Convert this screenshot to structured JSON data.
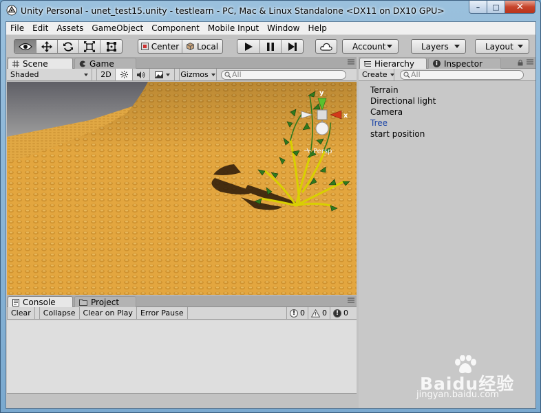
{
  "window": {
    "title": "Unity Personal - unet_test15.unity - testlearn - PC, Mac & Linux Standalone <DX11 on DX10 GPU>",
    "controls": {
      "minimize": "–",
      "maximize": "□",
      "close": "✕"
    }
  },
  "menu": {
    "items": [
      "File",
      "Edit",
      "Assets",
      "GameObject",
      "Component",
      "Mobile Input",
      "Window",
      "Help"
    ]
  },
  "toolbar": {
    "tools": [
      "view-tool",
      "move-tool",
      "rotate-tool",
      "scale-tool",
      "rect-tool"
    ],
    "pivot": {
      "center_label": "Center",
      "local_label": "Local"
    },
    "play_controls": [
      "play",
      "pause",
      "step"
    ],
    "account_label": "Account",
    "layers_label": "Layers",
    "layout_label": "Layout"
  },
  "scene": {
    "tabs": {
      "scene": "Scene",
      "game": "Game"
    },
    "shading": "Shaded",
    "mode_2d": "2D",
    "gizmos": "Gizmos",
    "search_placeholder": "All",
    "gizmo": {
      "y": "y",
      "x": "x",
      "persp": "Persp"
    }
  },
  "console": {
    "tabs": {
      "console": "Console",
      "project": "Project"
    },
    "buttons": [
      "Clear",
      "Collapse",
      "Clear on Play",
      "Error Pause"
    ],
    "counts": {
      "info": "0",
      "warning": "0",
      "error": "0"
    }
  },
  "hierarchy": {
    "tabs": {
      "hierarchy": "Hierarchy",
      "inspector": "Inspector"
    },
    "create_label": "Create",
    "search_placeholder": "All",
    "items": [
      {
        "label": "Terrain",
        "selected": false
      },
      {
        "label": "Directional light",
        "selected": false
      },
      {
        "label": "Camera",
        "selected": false
      },
      {
        "label": "Tree",
        "selected": true
      },
      {
        "label": "start position",
        "selected": false
      }
    ]
  },
  "colors": {
    "selected_text": "#1d46a7",
    "editor_gray": "#c2c2c2",
    "terrain": "#e0a23a"
  },
  "watermark": {
    "brand": "Baidu经验",
    "url": "jingyan.baidu.com"
  }
}
